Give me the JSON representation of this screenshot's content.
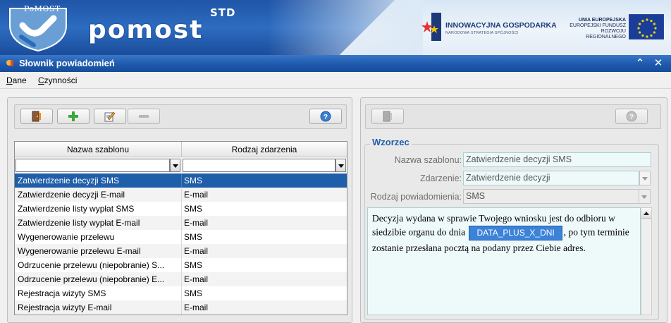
{
  "banner": {
    "logo_small": "PoMOST",
    "logo_big": "pomost",
    "logo_std": "STD",
    "ig_title": "INNOWACYJNA GOSPODARKA",
    "ig_subtitle": "NARODOWA STRATEGIA SPÓJNOŚCI",
    "ue_line1": "UNIA EUROPEJSKA",
    "ue_line2": "EUROPEJSKI FUNDUSZ",
    "ue_line3": "ROZWOJU REGIONALNEGO"
  },
  "window": {
    "title": "Słownik powiadomień",
    "minimize_glyph": "⌃",
    "close_glyph": "✕"
  },
  "menu": {
    "dane_u": "D",
    "dane_rest": "ane",
    "czynnosci_u": "C",
    "czynnosci_rest": "zynności"
  },
  "grid": {
    "col1": "Nazwa szablonu",
    "col2": "Rodzaj zdarzenia",
    "filter1": "",
    "filter2": "",
    "rows": [
      {
        "name": "Zatwierdzenie decyzji SMS",
        "type": "SMS",
        "selected": true
      },
      {
        "name": "Zatwierdzenie decyzji E-mail",
        "type": "E-mail"
      },
      {
        "name": "Zatwierdzenie listy wypłat SMS",
        "type": "SMS"
      },
      {
        "name": "Zatwierdzenie listy wypłat E-mail",
        "type": "E-mail"
      },
      {
        "name": "Wygenerowanie przelewu",
        "type": "SMS"
      },
      {
        "name": "Wygenerowanie przelewu E-mail",
        "type": "E-mail"
      },
      {
        "name": "Odrzucenie przelewu (niepobranie) S...",
        "type": "SMS"
      },
      {
        "name": "Odrzucenie przelewu (niepobranie) E...",
        "type": "E-mail"
      },
      {
        "name": "Rejestracja wizyty SMS",
        "type": "SMS"
      },
      {
        "name": "Rejestracja wizyty E-mail",
        "type": "E-mail"
      }
    ]
  },
  "form": {
    "legend": "Wzorzec",
    "name_label": "Nazwa szablonu:",
    "name_value": "Zatwierdzenie decyzji SMS",
    "event_label": "Zdarzenie:",
    "event_value": "Zatwierdzenie decyzji",
    "kind_label": "Rodzaj powiadomienia:",
    "kind_value": "SMS",
    "text_part1": "Decyzja wydana w sprawie Twojego wniosku jest do odbioru w",
    "text_part2": "siedzibie organu do dnia",
    "token": "DATA_PLUS_X_DNI",
    "text_part3": ", po tym terminie",
    "text_part4": "zostanie przesłana pocztą na podany przez Ciebie adres."
  },
  "colors": {
    "title_bar": "#1d59ad",
    "selected_row": "#1f5ea8",
    "legend": "#1f5ea8",
    "token": "#3b82d8"
  },
  "icons": {
    "toolbar_left": [
      "exit-icon",
      "add-icon",
      "edit-icon",
      "remove-icon",
      "help-icon"
    ],
    "toolbar_right": [
      "exit-icon",
      "help-icon"
    ]
  }
}
